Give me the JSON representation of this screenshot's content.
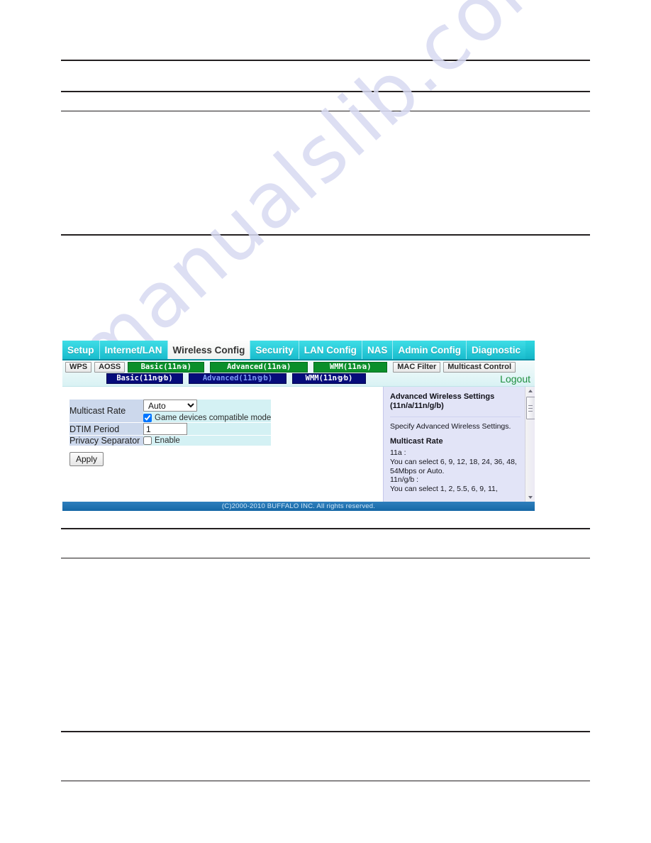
{
  "page": {
    "watermark_text": "manualslib.com"
  },
  "router_ui": {
    "nav_tabs": [
      {
        "label": "Setup",
        "active": false
      },
      {
        "label": "Internet/LAN",
        "active": false
      },
      {
        "label": "Wireless Config",
        "active": true
      },
      {
        "label": "Security",
        "active": false
      },
      {
        "label": "LAN Config",
        "active": false
      },
      {
        "label": "NAS",
        "active": false
      },
      {
        "label": "Admin Config",
        "active": false
      },
      {
        "label": "Diagnostic",
        "active": false
      }
    ],
    "subnav_row1": [
      {
        "label": "WPS",
        "style": "plain"
      },
      {
        "label": "AOSS",
        "style": "plain"
      },
      {
        "label": "Basic(11n⁄a)",
        "style": "green"
      },
      {
        "label": "Advanced(11n⁄a)",
        "style": "green"
      },
      {
        "label": "WMM(11n⁄a)",
        "style": "green"
      },
      {
        "label": "MAC Filter",
        "style": "plain"
      },
      {
        "label": "Multicast Control",
        "style": "plain"
      }
    ],
    "subnav_row2": [
      {
        "label": "Basic(11n⁄g⁄b)",
        "style": "navy",
        "selected": false
      },
      {
        "label": "Advanced(11n⁄g⁄b)",
        "style": "navy",
        "selected": true
      },
      {
        "label": "WMM(11n⁄g⁄b)",
        "style": "navy",
        "selected": false
      }
    ],
    "logout_label": "Logout",
    "settings": {
      "rows": [
        {
          "label": "Multicast Rate",
          "select_value": "Auto",
          "checkbox_label": "Game devices compatible mode",
          "checkbox_checked": true
        },
        {
          "label": "DTIM Period",
          "input_value": "1"
        },
        {
          "label": "Privacy Separator",
          "checkbox_label": "Enable",
          "checkbox_checked": false
        }
      ],
      "apply_label": "Apply"
    },
    "help": {
      "title": "Advanced Wireless Settings (11n/a/11n/g/b)",
      "intro": "Specify Advanced Wireless Settings.",
      "section_heading": "Multicast Rate",
      "line_11a_label": "11a :",
      "line_11a_text": "You can select 6, 9, 12, 18, 24, 36, 48, 54Mbps or Auto.",
      "line_11ngb_label": "11n/g/b :",
      "line_11ngb_text": "You can select 1, 2, 5.5, 6, 9, 11,"
    },
    "footer_text": "(C)2000-2010 BUFFALO INC. All rights reserved.",
    "colors": {
      "nav_tab": "#2fd7e0",
      "subnav_green": "#0a8f2a",
      "subnav_navy": "#060c7a",
      "subnav_selected_text": "#7f9cf5",
      "label_cell": "#ccd8ec",
      "value_cell": "#d4f1f4",
      "help_background": "#e2e4f7",
      "footer": "#1668a6",
      "logout": "#1f8f3f"
    }
  }
}
